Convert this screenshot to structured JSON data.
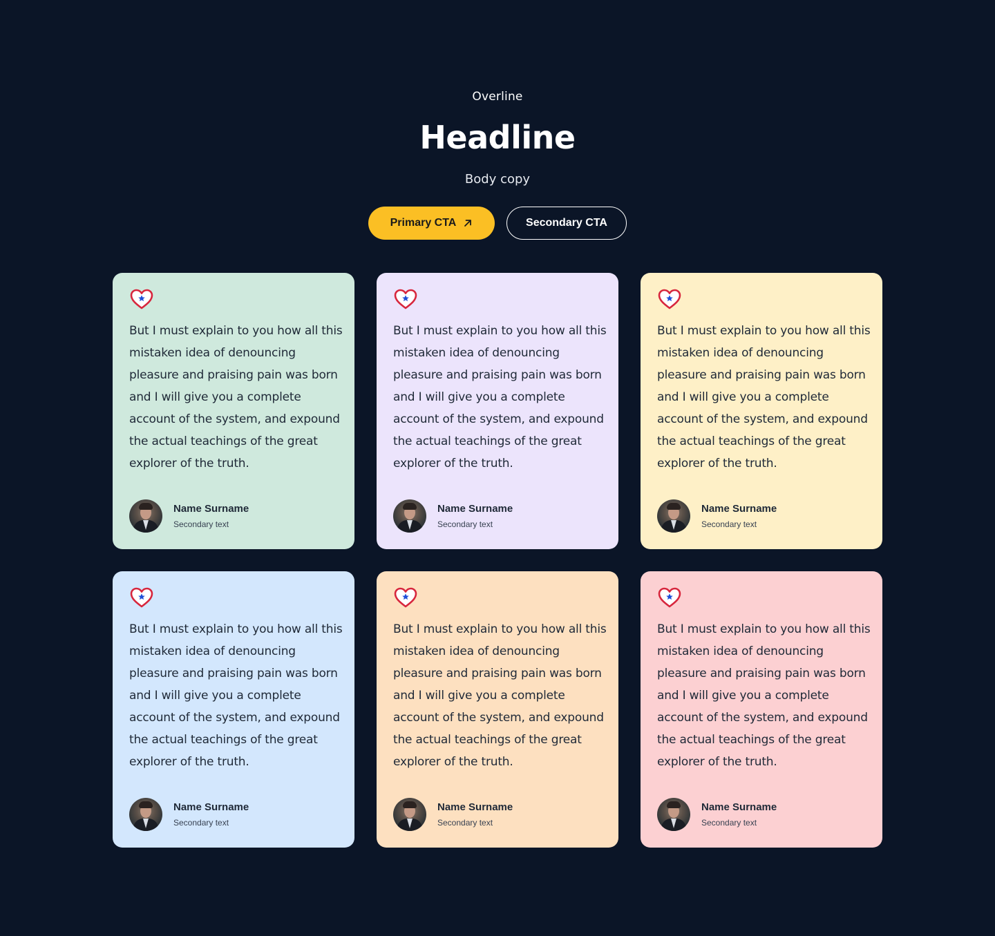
{
  "hero": {
    "overline": "Overline",
    "headline": "Headline",
    "body": "Body copy",
    "primary_cta": "Primary CTA",
    "secondary_cta": "Secondary CTA"
  },
  "colors": {
    "background": "#0b1527",
    "primary_button": "#fbbf24",
    "card_green": "#cfe9dd",
    "card_purple": "#ece4fc",
    "card_yellow": "#fef0c7",
    "card_blue": "#d3e7fd",
    "card_orange": "#fde0c0",
    "card_pink": "#fcd0d2",
    "heart_red": "#d7263d",
    "star_blue": "#1d4ed8"
  },
  "icons": {
    "primary_cta": "arrow-up-right-icon",
    "card": "heart-star-icon"
  },
  "testimonials": [
    {
      "quote": "But I must explain to you how all this mistaken idea of denouncing pleasure and praising pain was born and I will give you a complete account of the system, and expound the actual teachings of the great explorer of the truth.",
      "name": "Name Surname",
      "secondary": "Secondary text"
    },
    {
      "quote": "But I must explain to you how all this mistaken idea of denouncing pleasure and praising pain was born and I will give you a complete account of the system, and expound the actual teachings of the great explorer of the truth.",
      "name": "Name Surname",
      "secondary": "Secondary text"
    },
    {
      "quote": "But I must explain to you how all this mistaken idea of denouncing pleasure and praising pain was born and I will give you a complete account of the system, and expound the actual teachings of the great explorer of the truth.",
      "name": "Name Surname",
      "secondary": "Secondary text"
    },
    {
      "quote": "But I must explain to you how all this mistaken idea of denouncing pleasure and praising pain was born and I will give you a complete account of the system, and expound the actual teachings of the great explorer of the truth.",
      "name": "Name Surname",
      "secondary": "Secondary text"
    },
    {
      "quote": "But I must explain to you how all this mistaken idea of denouncing pleasure and praising pain was born and I will give you a complete account of the system, and expound the actual teachings of the great explorer of the truth.",
      "name": "Name Surname",
      "secondary": "Secondary text"
    },
    {
      "quote": "But I must explain to you how all this mistaken idea of denouncing pleasure and praising pain was born and I will give you a complete account of the system, and expound the actual teachings of the great explorer of the truth.",
      "name": "Name Surname",
      "secondary": "Secondary text"
    }
  ]
}
